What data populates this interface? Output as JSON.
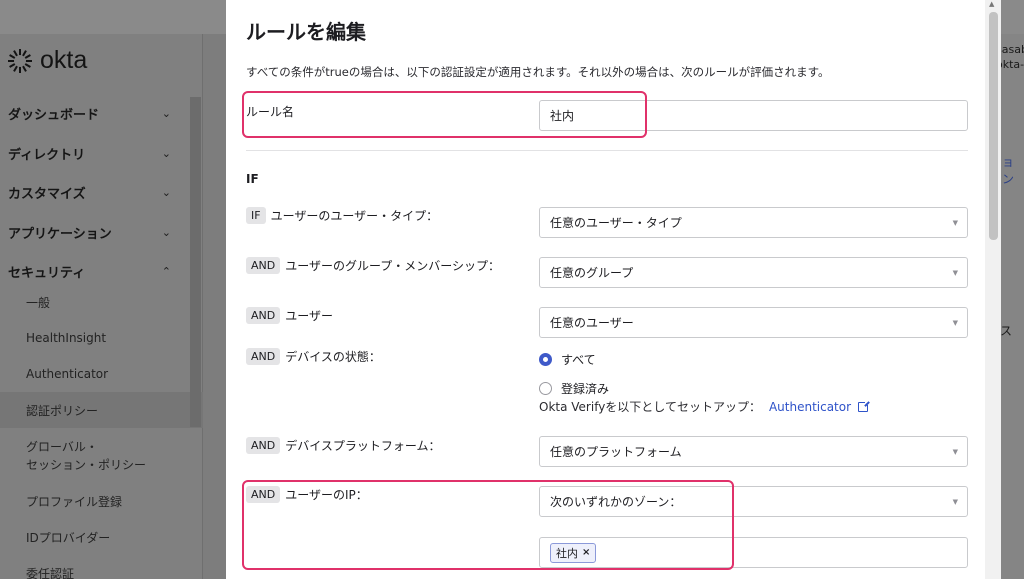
{
  "background": {
    "logo_text": "okta",
    "nav": [
      {
        "label": "ダッシュボード",
        "expanded": false
      },
      {
        "label": "ディレクトリ",
        "expanded": false
      },
      {
        "label": "カスタマイズ",
        "expanded": false
      },
      {
        "label": "アプリケーション",
        "expanded": false
      },
      {
        "label": "セキュリティ",
        "expanded": true
      }
    ],
    "security_sub": {
      "general": "一般",
      "healthinsight": "HealthInsight",
      "authenticator": "Authenticator",
      "auth_policy": "認証ポリシー",
      "global_line1": "グローバル・",
      "global_line2": "セッション・ポリシー",
      "profile_enroll": "プロファイル登録",
      "idp": "IDプロバイダー",
      "delegated": "委任認証"
    },
    "right_top_1": "sasaba",
    "right_top_2": "okta-c",
    "right_link": "ョン",
    "right_mid": "ス"
  },
  "modal": {
    "title": "ルールを編集",
    "description": "すべての条件がtrueの場合は、以下の認証設定が適用されます。それ以外の場合は、次のルールが評価されます。",
    "rule_name_label": "ルール名",
    "rule_name_value": "社内",
    "section_if": "IF",
    "conditions": {
      "user_type": {
        "chip": "IF",
        "label": "ユーザーのユーザー・タイプ：",
        "value": "任意のユーザー・タイプ"
      },
      "group": {
        "chip": "AND",
        "label": "ユーザーのグループ・メンバーシップ：",
        "value": "任意のグループ"
      },
      "user": {
        "chip": "AND",
        "label": "ユーザー",
        "value": "任意のユーザー"
      },
      "device_state": {
        "chip": "AND",
        "label": "デバイスの状態：",
        "option_all": "すべて",
        "option_registered": "登録済み",
        "selected": "すべて",
        "okta_verify_text": "Okta Verifyを以下としてセットアップ：",
        "okta_verify_link": "Authenticator"
      },
      "platform": {
        "chip": "AND",
        "label": "デバイスプラットフォーム：",
        "value": "任意のプラットフォーム"
      },
      "ip": {
        "chip": "AND",
        "label": "ユーザーのIP：",
        "value": "次のいずれかのゾーン：",
        "tag": "社内",
        "tag_remove": "×"
      }
    }
  },
  "colors": {
    "accent": "#3f5ac9",
    "highlight": "#e0316a",
    "link": "#2f53c9"
  }
}
